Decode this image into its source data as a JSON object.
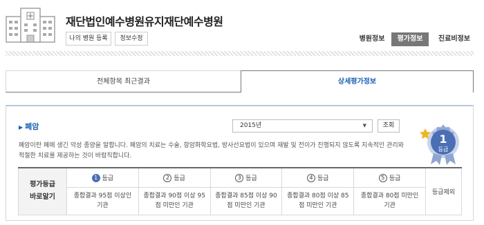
{
  "header": {
    "hospital_name": "재단법인예수병원유지재단예수병원",
    "btn_register": "나의 병원 등록",
    "btn_edit": "정보수정",
    "nav": [
      "병원정보",
      "평가정보",
      "진료비정보"
    ],
    "active_nav": "평가정보"
  },
  "tabs": {
    "overall": "전체항목 최근결과",
    "detail": "상세평가정보",
    "active": "상세평가정보"
  },
  "panel": {
    "disease": "폐암",
    "year_select": "2015년",
    "search_btn": "조회",
    "description": "폐암이란 폐에 생긴 악성 종양을 말합니다. 폐암의 치료는 수술, 항암화학요법, 방사선요법이 있으며 재발 및 전이가 진행되지 않도록 지속적인 관리와 적절한 치료를 제공하는 것이 바람직합니다.",
    "badge": {
      "number": "1",
      "label": "등급",
      "color": "#4a6fb5"
    }
  },
  "grades": {
    "row_header": "평가등급\n바로알기",
    "items": [
      {
        "num": "1",
        "label": "등급",
        "desc": "종합결과 95점 이상인 기관"
      },
      {
        "num": "2",
        "label": "등급",
        "desc": "종합결과 90점 이상 95점 미만인 기관"
      },
      {
        "num": "3",
        "label": "등급",
        "desc": "종합결과 85점 이상 90점 미만인 기관"
      },
      {
        "num": "4",
        "label": "등급",
        "desc": "종합결과 80점 이상 85점 미만인 기관"
      },
      {
        "num": "5",
        "label": "등급",
        "desc": "종합결과 80점 미만인 기관"
      }
    ],
    "excluded": "등급제외",
    "active_grade": "1"
  }
}
